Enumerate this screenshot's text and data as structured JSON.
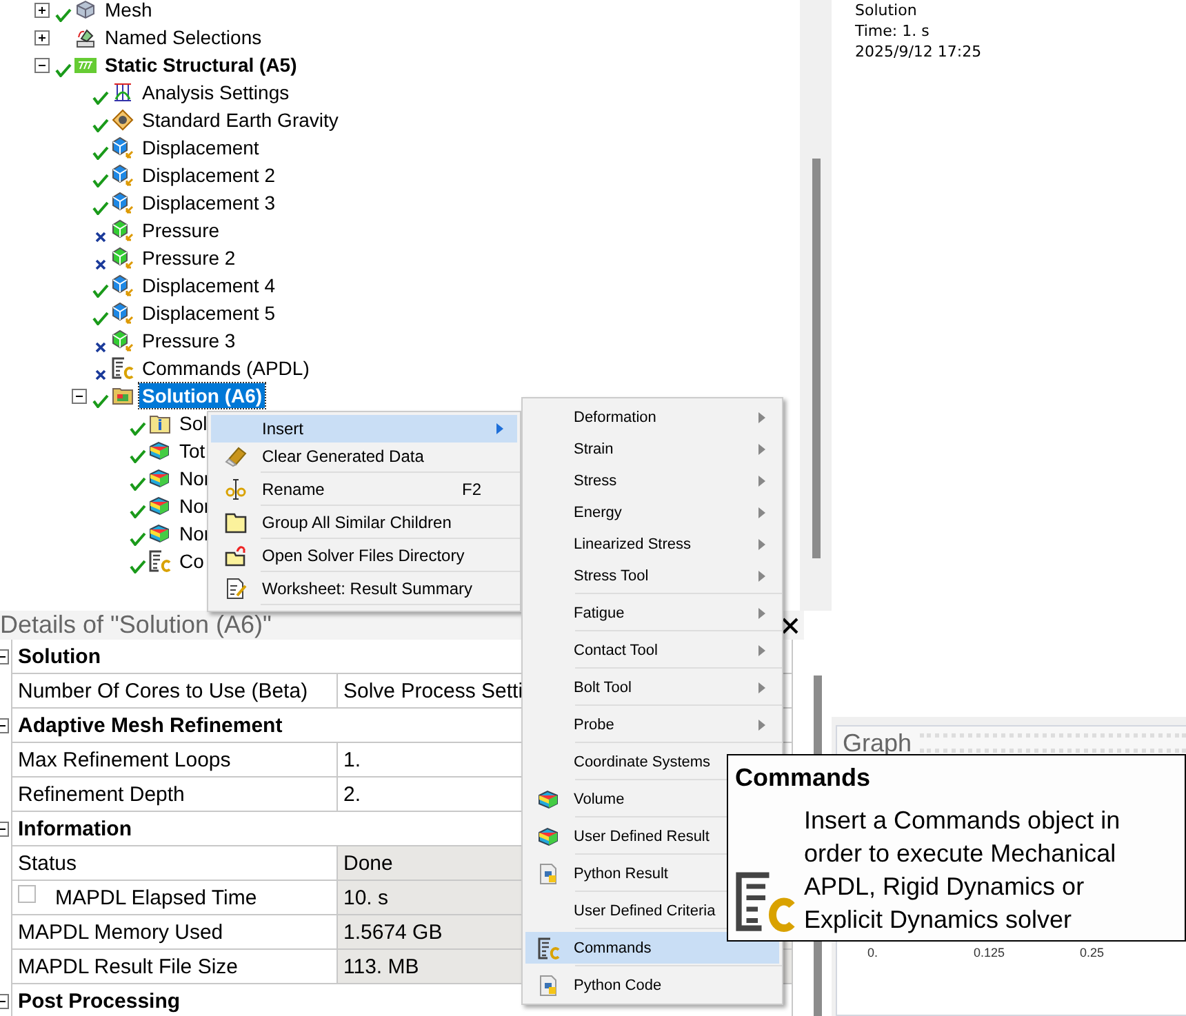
{
  "tree": [
    {
      "label": "Mesh",
      "kind": "mesh",
      "solved": true,
      "expanded": false,
      "selected": false,
      "bold": false
    },
    {
      "label": "Named Selections",
      "kind": "named",
      "expanded": false,
      "selected": false,
      "bold": false
    },
    {
      "label": "Static Structural (A5)",
      "kind": "static",
      "solved": true,
      "expanded": true,
      "selected": false,
      "bold": true,
      "children": [
        {
          "label": "Analysis Settings",
          "kind": "settings",
          "solved": true,
          "selected": false,
          "bold": false
        },
        {
          "label": "Standard Earth Gravity",
          "kind": "gravity",
          "solved": true,
          "selected": false,
          "bold": false
        },
        {
          "label": "Displacement",
          "kind": "displacement",
          "solved": true,
          "selected": false,
          "bold": false
        },
        {
          "label": "Displacement 2",
          "kind": "displacement",
          "solved": true,
          "selected": false,
          "bold": false
        },
        {
          "label": "Displacement 3",
          "kind": "displacement",
          "solved": true,
          "selected": false,
          "bold": false
        },
        {
          "label": "Pressure",
          "kind": "pressure",
          "solved": false,
          "selected": false,
          "bold": false
        },
        {
          "label": "Pressure 2",
          "kind": "pressure",
          "solved": false,
          "selected": false,
          "bold": false
        },
        {
          "label": "Displacement 4",
          "kind": "displacement",
          "solved": true,
          "selected": false,
          "bold": false
        },
        {
          "label": "Displacement 5",
          "kind": "displacement",
          "solved": true,
          "selected": false,
          "bold": false
        },
        {
          "label": "Pressure 3",
          "kind": "pressure",
          "solved": false,
          "selected": false,
          "bold": false
        },
        {
          "label": "Commands (APDL)",
          "kind": "commands",
          "solved": false,
          "selected": false,
          "bold": false
        },
        {
          "label": "Solution (A6)",
          "kind": "solution",
          "solved": true,
          "expanded": true,
          "selected": true,
          "bold": true,
          "children": [
            {
              "label": "Sol",
              "kind": "info",
              "solved": true,
              "selected": false,
              "bold": false
            },
            {
              "label": "Tot",
              "kind": "result",
              "solved": true,
              "selected": false,
              "bold": false
            },
            {
              "label": "Nor",
              "kind": "result",
              "solved": true,
              "selected": false,
              "bold": false
            },
            {
              "label": "Nor",
              "kind": "result",
              "solved": true,
              "selected": false,
              "bold": false
            },
            {
              "label": "Nor",
              "kind": "result",
              "solved": true,
              "selected": false,
              "bold": false
            },
            {
              "label": "Co",
              "kind": "commands",
              "solved": true,
              "selected": false,
              "bold": false
            }
          ]
        }
      ]
    }
  ],
  "viewer": {
    "lines": [
      "Solution",
      "Time: 1. s",
      "2025/9/12 17:25"
    ]
  },
  "details": {
    "title": "Details of \"Solution (A6)\"",
    "sections": [
      {
        "title": "Solution",
        "expanded": true,
        "rows": [
          {
            "label": "Number Of Cores to Use (Beta)",
            "value": "Solve Process Setti",
            "readonly": false
          }
        ]
      },
      {
        "title": "Adaptive Mesh Refinement",
        "expanded": true,
        "rows": [
          {
            "label": "Max Refinement Loops",
            "value": "1.",
            "readonly": false
          },
          {
            "label": "Refinement Depth",
            "value": "2.",
            "readonly": false
          }
        ]
      },
      {
        "title": "Information",
        "expanded": true,
        "rows": [
          {
            "label": "Status",
            "value": "Done",
            "readonly": true
          },
          {
            "label": "MAPDL Elapsed Time",
            "value": "10. s",
            "readonly": true,
            "checked": false
          },
          {
            "label": "MAPDL Memory Used",
            "value": "1.5674 GB",
            "readonly": true
          },
          {
            "label": "MAPDL Result File Size",
            "value": "113. MB",
            "readonly": true
          }
        ]
      },
      {
        "title": "Post Processing",
        "expanded": true
      }
    ]
  },
  "graph": {
    "title": "Graph",
    "ticks": [
      "0.",
      "0.125",
      "0.25"
    ]
  },
  "context_menu": [
    {
      "label": "Insert",
      "kind": "none",
      "has_submenu": true,
      "selected": true,
      "divider": false
    },
    {
      "label": "Clear Generated Data",
      "kind": "eraser",
      "has_submenu": false,
      "selected": false,
      "divider": true
    },
    {
      "label": "Rename",
      "kind": "rename",
      "shortcut": "F2",
      "has_submenu": false,
      "selected": false,
      "divider": true
    },
    {
      "label": "Group All Similar Children",
      "kind": "folder",
      "has_submenu": false,
      "selected": false,
      "divider": true
    },
    {
      "label": "Open Solver Files Directory",
      "kind": "open-folder",
      "has_submenu": false,
      "selected": false,
      "divider": true
    },
    {
      "label": "Worksheet: Result Summary",
      "kind": "worksheet",
      "has_submenu": false,
      "selected": false,
      "divider": true
    }
  ],
  "insert_menu": [
    {
      "label": "Deformation",
      "kind": "none",
      "has_submenu": true,
      "selected": false,
      "divider": false
    },
    {
      "label": "Strain",
      "kind": "none",
      "has_submenu": true,
      "selected": false,
      "divider": false
    },
    {
      "label": "Stress",
      "kind": "none",
      "has_submenu": true,
      "selected": false,
      "divider": false
    },
    {
      "label": "Energy",
      "kind": "none",
      "has_submenu": true,
      "selected": false,
      "divider": false
    },
    {
      "label": "Linearized Stress",
      "kind": "none",
      "has_submenu": true,
      "selected": false,
      "divider": false
    },
    {
      "label": "Stress Tool",
      "kind": "none",
      "has_submenu": true,
      "selected": false,
      "divider": true
    },
    {
      "label": "Fatigue",
      "kind": "none",
      "has_submenu": true,
      "selected": false,
      "divider": true
    },
    {
      "label": "Contact Tool",
      "kind": "none",
      "has_submenu": true,
      "selected": false,
      "divider": true
    },
    {
      "label": "Bolt Tool",
      "kind": "none",
      "has_submenu": true,
      "selected": false,
      "divider": true
    },
    {
      "label": "Probe",
      "kind": "none",
      "has_submenu": true,
      "selected": false,
      "divider": true
    },
    {
      "label": "Coordinate Systems",
      "kind": "none",
      "has_submenu": false,
      "selected": false,
      "divider": true
    },
    {
      "label": "Volume",
      "kind": "volume",
      "has_submenu": false,
      "selected": false,
      "divider": true
    },
    {
      "label": "User Defined Result",
      "kind": "user",
      "has_submenu": false,
      "selected": false,
      "divider": true
    },
    {
      "label": "Python Result",
      "kind": "python",
      "has_submenu": false,
      "selected": false,
      "divider": true
    },
    {
      "label": "User Defined Criteria",
      "kind": "none",
      "has_submenu": false,
      "selected": false,
      "divider": true
    },
    {
      "label": "Commands",
      "kind": "commands",
      "has_submenu": false,
      "selected": true,
      "divider": true
    },
    {
      "label": "Python Code",
      "kind": "python",
      "has_submenu": false,
      "selected": false,
      "divider": false
    }
  ],
  "tooltip": {
    "title": "Commands",
    "text": "Insert a Commands object in order to execute Mechanical APDL, Rigid Dynamics or Explicit Dynamics solver"
  }
}
